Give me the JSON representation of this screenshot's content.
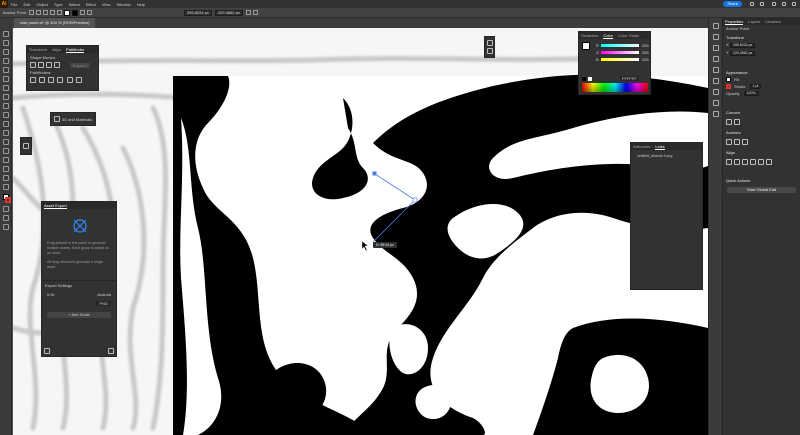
{
  "menubar": {
    "items": [
      "File",
      "Edit",
      "Object",
      "Type",
      "Select",
      "Effect",
      "View",
      "Window",
      "Help"
    ],
    "share_label": "Share"
  },
  "control_bar": {
    "object_label": "Anchor Point",
    "x_value": "395.8224 px",
    "y_value": "229.3862 px"
  },
  "document": {
    "tab_title": "side panel.ai* @ 400 % (RGB/Preview)"
  },
  "pathfinder_panel": {
    "tabs": [
      "Transform",
      "Align",
      "Pathfinder"
    ],
    "shape_modes_label": "Shape Modes:",
    "expand_label": "Expand",
    "pathfinders_label": "Pathfinders:"
  },
  "materials_panel": {
    "label": "3D and Materials"
  },
  "asset_export": {
    "title": "Asset Export",
    "drop_hint": "Drag artwork to this panel to generate multiple assets. Each group is added as an asset.",
    "alt_hint": "Alt drag artwork to generate a single asset.",
    "export_settings_label": "Export Settings",
    "scale_value": "0.5x",
    "platform_value": "Android",
    "format_value": "PNG",
    "add_scale_label": "+ Add Scale"
  },
  "color_panel": {
    "tabs": [
      "Swatches",
      "Color",
      "Color Guide"
    ],
    "channels": [
      {
        "name": "R",
        "value": "255"
      },
      {
        "name": "G",
        "value": "255"
      },
      {
        "name": "B",
        "value": "255"
      }
    ],
    "hex_value": "FFFFFF",
    "accent_spectrum": [
      "#ff0000",
      "#ffff00",
      "#00ff00",
      "#00ffff",
      "#0000ff",
      "#ff00ff",
      "#ff0000"
    ]
  },
  "links_panel": {
    "tabs": [
      "Artboards",
      "Links"
    ],
    "item": "Untitled_Artwork 9.png"
  },
  "properties_panel": {
    "tabs": [
      "Properties",
      "Layers",
      "Libraries"
    ],
    "selection_label": "Anchor Point",
    "transform_label": "Transform",
    "x_value": "395.8224 px",
    "y_value": "229.3862 px",
    "appearance_label": "Appearance",
    "fill_label": "Fill",
    "stroke_label": "Stroke",
    "stroke_weight": "1 pt",
    "opacity_label": "Opacity",
    "opacity_value": "100%",
    "convert_label": "Convert",
    "anchors_label": "Anchors",
    "align_label": "Align",
    "quick_actions_label": "Quick Actions",
    "quick_action_button": "Start Global Edit"
  },
  "canvas": {
    "tooltip": "D: 89.04 px"
  },
  "colors": {
    "accent": "#1473e6",
    "ui_dark": "#323232",
    "ui_mid": "#535353",
    "artwork_black": "#000000",
    "artwork_gray": "#c8c8c8",
    "stroke_swatch": "#e03030"
  }
}
